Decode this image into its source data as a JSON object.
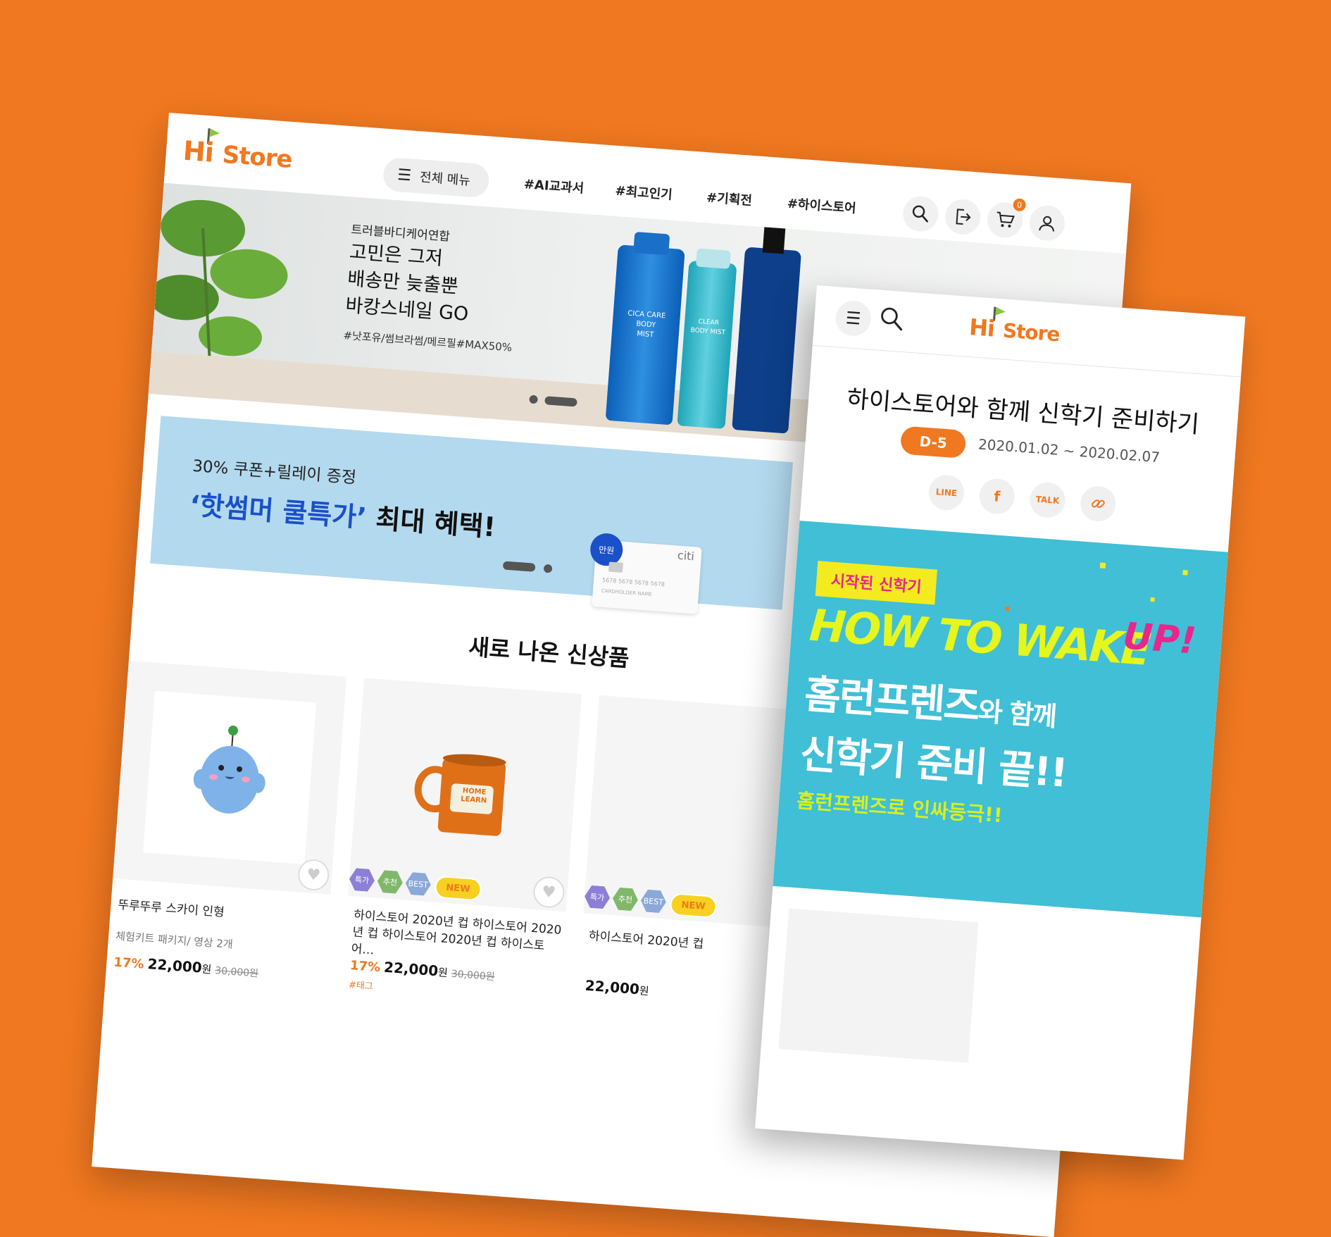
{
  "brand": {
    "logo_hi": "Hi",
    "logo_store": "Store",
    "accent": "#f07820",
    "background": "#f07820"
  },
  "desktop": {
    "menu_label": "전체 메뉴",
    "nav": [
      "#AI교과서",
      "#최고인기",
      "#기획전",
      "#하이스토어"
    ],
    "cart_count": "0",
    "hero": {
      "small": "트러블바디케어연합",
      "line1": "고민은 그저",
      "line2": "배송만 늦출뿐",
      "line3": "바캉스네일 GO",
      "tags": "#낫포유/썸브라썸/메르필#MAX50%",
      "bottle1_text": "CICA CARE BODY MIST",
      "bottle2_text": "CLEAR BODY MIST"
    },
    "promo": {
      "small": "30% 쿠폰+릴레이 증정",
      "highlight": "‘핫썸머 쿨특가’",
      "rest": "최대 혜택!",
      "card_badge": "만원",
      "card_brand": "citi",
      "card_number": "5678 5678 5678 5678",
      "card_holder": "CARDHOLDER NAME"
    },
    "section_title": "새로 나온 신상품",
    "products": [
      {
        "name": "뚜루뚜루 스카이 인형",
        "sub": "체험키트 패키지/ 영상 2개",
        "discount": "17%",
        "price": "22,000",
        "won": "원",
        "original": "30,000원"
      },
      {
        "badges": [
          "특가",
          "추천",
          "BEST"
        ],
        "new": "NEW",
        "mug_text": "HOME LEARN",
        "name": "하이스토어 2020년 컵 하이스토어 2020년 컵 하이스토어 2020년 컵 하이스토어…",
        "discount": "17%",
        "price": "22,000",
        "won": "원",
        "original": "30,000원",
        "tag": "#태그"
      },
      {
        "badges": [
          "특가",
          "추천",
          "BEST"
        ],
        "new": "NEW",
        "name": "하이스토어 2020년 컵",
        "price": "22,000",
        "won": "원"
      }
    ]
  },
  "mobile": {
    "title": "하이스토어와 함께 신학기 준비하기",
    "dday": "D-5",
    "date_range": "2020.01.02 ~ 2020.02.07",
    "share": [
      "LINE",
      "f",
      "TALK"
    ],
    "banner": {
      "tag": "시작된 신학기",
      "headline": "HOW TO WAKE",
      "up": "UP!",
      "line2a": "홈런프렌즈",
      "line2b": "와 함께",
      "line3": "신학기 준비 끝!!",
      "line4": "홈런프렌즈로 인싸등극!!"
    }
  }
}
